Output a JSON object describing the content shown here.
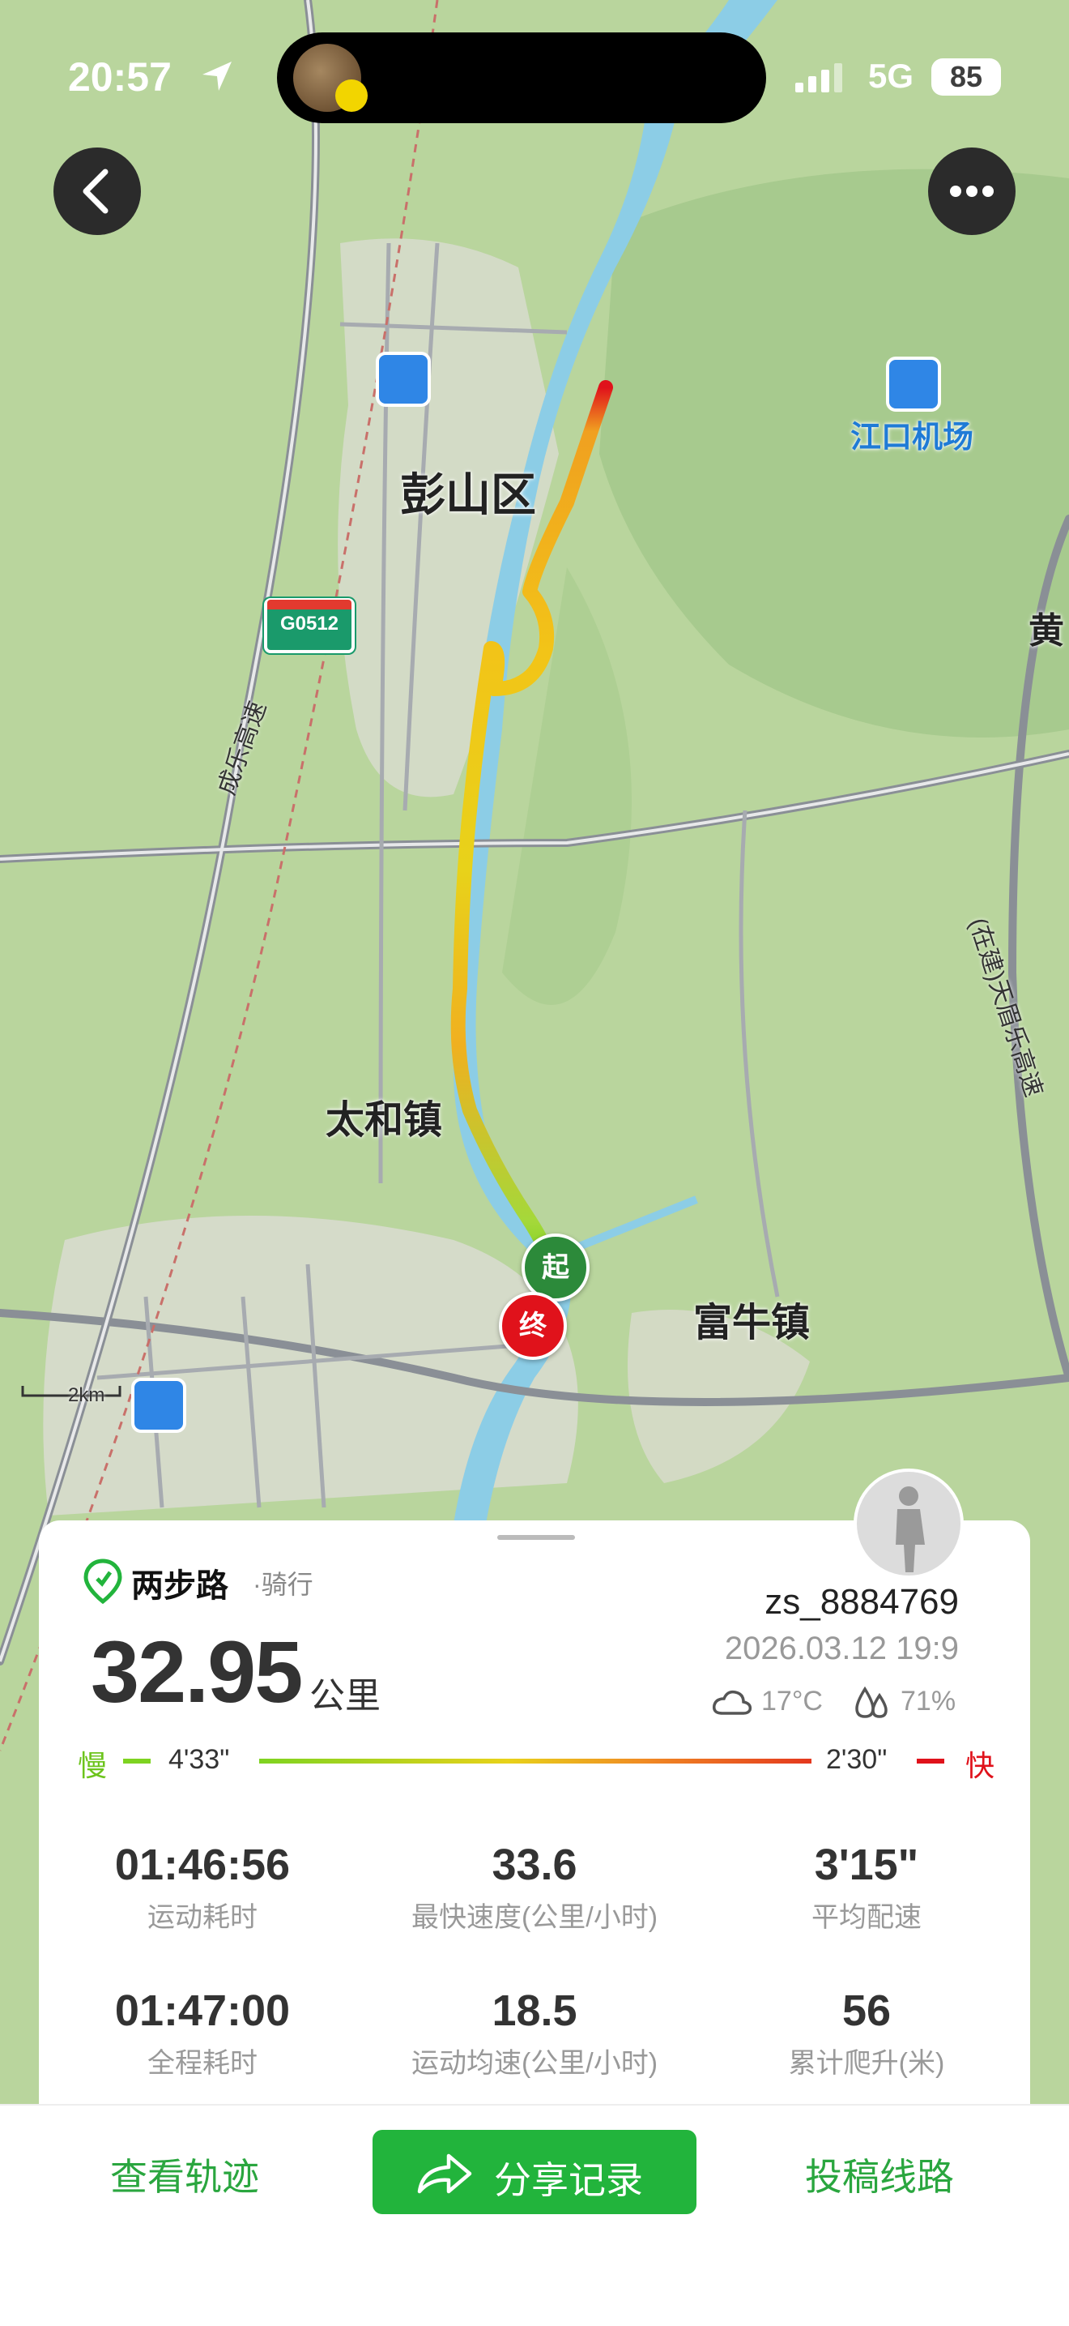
{
  "status_bar": {
    "time": "20:57",
    "network": "5G",
    "battery": "85"
  },
  "nav": {
    "back_icon": "chevron-left-icon",
    "more_icon": "more-horizontal-icon"
  },
  "map": {
    "labels": {
      "pengshan": "彭山区",
      "taihe": "太和镇",
      "funiu": "富牛镇",
      "airport": "江口机场",
      "huang": "黄",
      "expressway_west": "成乐高速",
      "expressway_east": "(在建)天眉乐高速",
      "highway_shield": "G0512",
      "scale": "2km"
    },
    "markers": {
      "start": "起",
      "end": "终"
    }
  },
  "summary": {
    "brand": "两步路",
    "activity": "·骑行",
    "distance": "32.95",
    "distance_unit": "公里",
    "username": "zs_8884769",
    "datetime": "2026.03.12 19:9",
    "temperature": "17°C",
    "humidity": "71%",
    "pace": {
      "slow_label": "慢",
      "slow_value": "4'33\"",
      "fast_value": "2'30\"",
      "fast_label": "快"
    },
    "stats": [
      {
        "value": "01:46:56",
        "label": "运动耗时"
      },
      {
        "value": "33.6",
        "label": "最快速度(公里/小时)"
      },
      {
        "value": "3'15\"",
        "label": "平均配速"
      },
      {
        "value": "01:47:00",
        "label": "全程耗时"
      },
      {
        "value": "18.5",
        "label": "运动均速(公里/小时)"
      },
      {
        "value": "56",
        "label": "累计爬升(米)"
      }
    ]
  },
  "bottom_bar": {
    "view_track": "查看轨迹",
    "share": "分享记录",
    "submit_route": "投稿线路"
  },
  "colors": {
    "accent": "#22b43c",
    "route_slow": "#7ed321",
    "route_fast": "#e0121b",
    "river": "#8ccde6"
  }
}
